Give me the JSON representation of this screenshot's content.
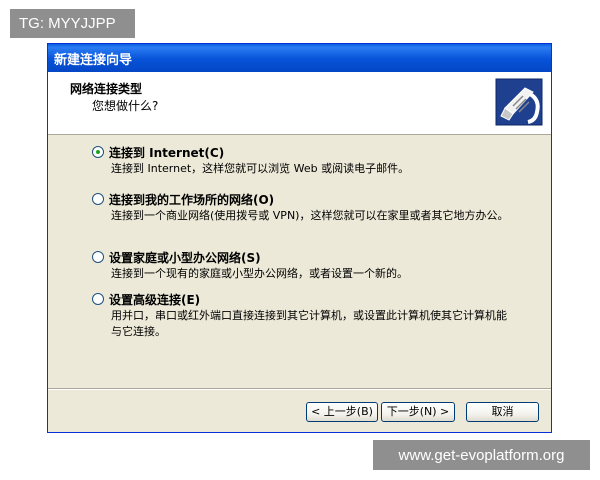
{
  "watermarks": {
    "top_tag": "TG: MYYJJPP",
    "bottom_tag": "www.get-evoplatform.org"
  },
  "window": {
    "title": "新建连接向导"
  },
  "header": {
    "title": "网络连接类型",
    "subtitle": "您想做什么?",
    "icon": "network-cable-icon"
  },
  "options": [
    {
      "label": "连接到 Internet(C)",
      "description": "连接到 Internet，这样您就可以浏览 Web 或阅读电子邮件。",
      "selected": true
    },
    {
      "label": "连接到我的工作场所的网络(O)",
      "description": "连接到一个商业网络(使用拨号或 VPN)，这样您就可以在家里或者其它地方办公。",
      "selected": false
    },
    {
      "label": "设置家庭或小型办公网络(S)",
      "description": "连接到一个现有的家庭或小型办公网络，或者设置一个新的。",
      "selected": false
    },
    {
      "label": "设置高级连接(E)",
      "description": "用并口，串口或红外端口直接连接到其它计算机，或设置此计算机使其它计算机能与它连接。",
      "selected": false
    }
  ],
  "buttons": {
    "back": "< 上一步(B)",
    "next": "下一步(N) >",
    "cancel": "取消"
  },
  "colors": {
    "title_bar": "#0652d8",
    "dialog_bg": "#ece9d8",
    "radio_selected": "#21a121"
  }
}
